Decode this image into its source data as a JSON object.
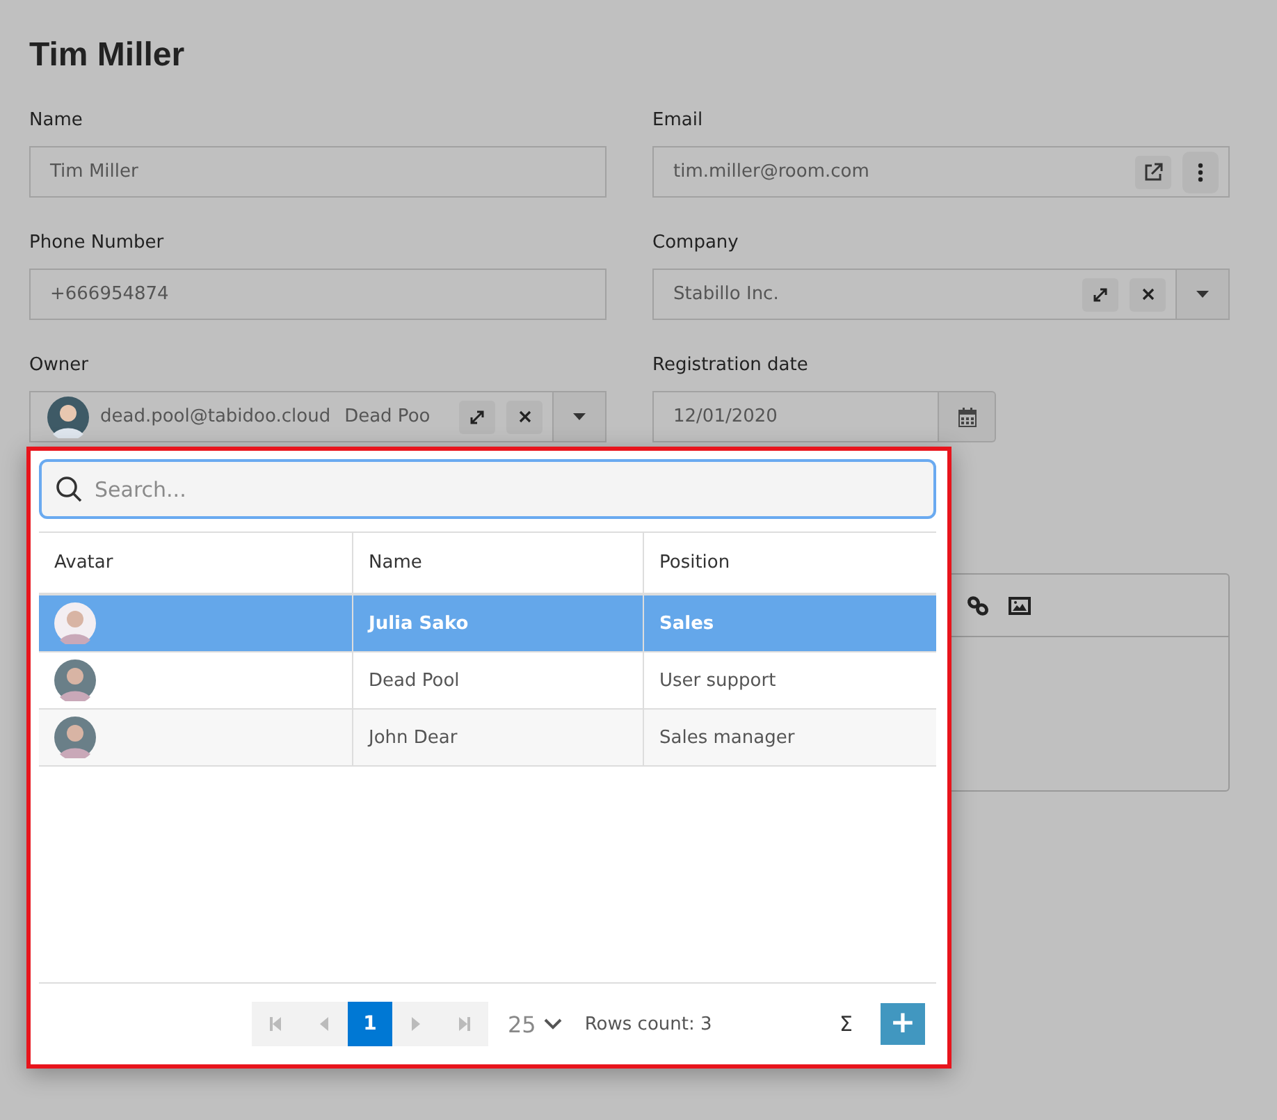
{
  "title": "Tim Miller",
  "fields": [
    {
      "label": "Name",
      "value": "Tim Miller",
      "kind": "text"
    },
    {
      "label": "Email",
      "value": "tim.miller@room.com",
      "kind": "email"
    },
    {
      "label": "Phone Number",
      "value": "+666954874",
      "kind": "text"
    },
    {
      "label": "Company",
      "value": "Stabillo Inc.",
      "kind": "link"
    },
    {
      "label": "Owner",
      "value": "dead.pool@tabidoo.cloud",
      "extra": "Dead Poo",
      "kind": "user"
    },
    {
      "label": "Registration date",
      "value": "12/01/2020",
      "kind": "date"
    }
  ],
  "popup": {
    "search": {
      "placeholder": "Search..."
    },
    "columns": [
      "Avatar",
      "Name",
      "Position"
    ],
    "rows": [
      {
        "name": "Julia Sako",
        "position": "Sales",
        "selected": true
      },
      {
        "name": "Dead Pool",
        "position": "User support",
        "selected": false
      },
      {
        "name": "John Dear",
        "position": "Sales manager",
        "selected": false
      }
    ],
    "pager": {
      "page": "1",
      "page_size": "25",
      "rows_count": "Rows count: 3",
      "sum": "Σ",
      "add": "+"
    }
  }
}
